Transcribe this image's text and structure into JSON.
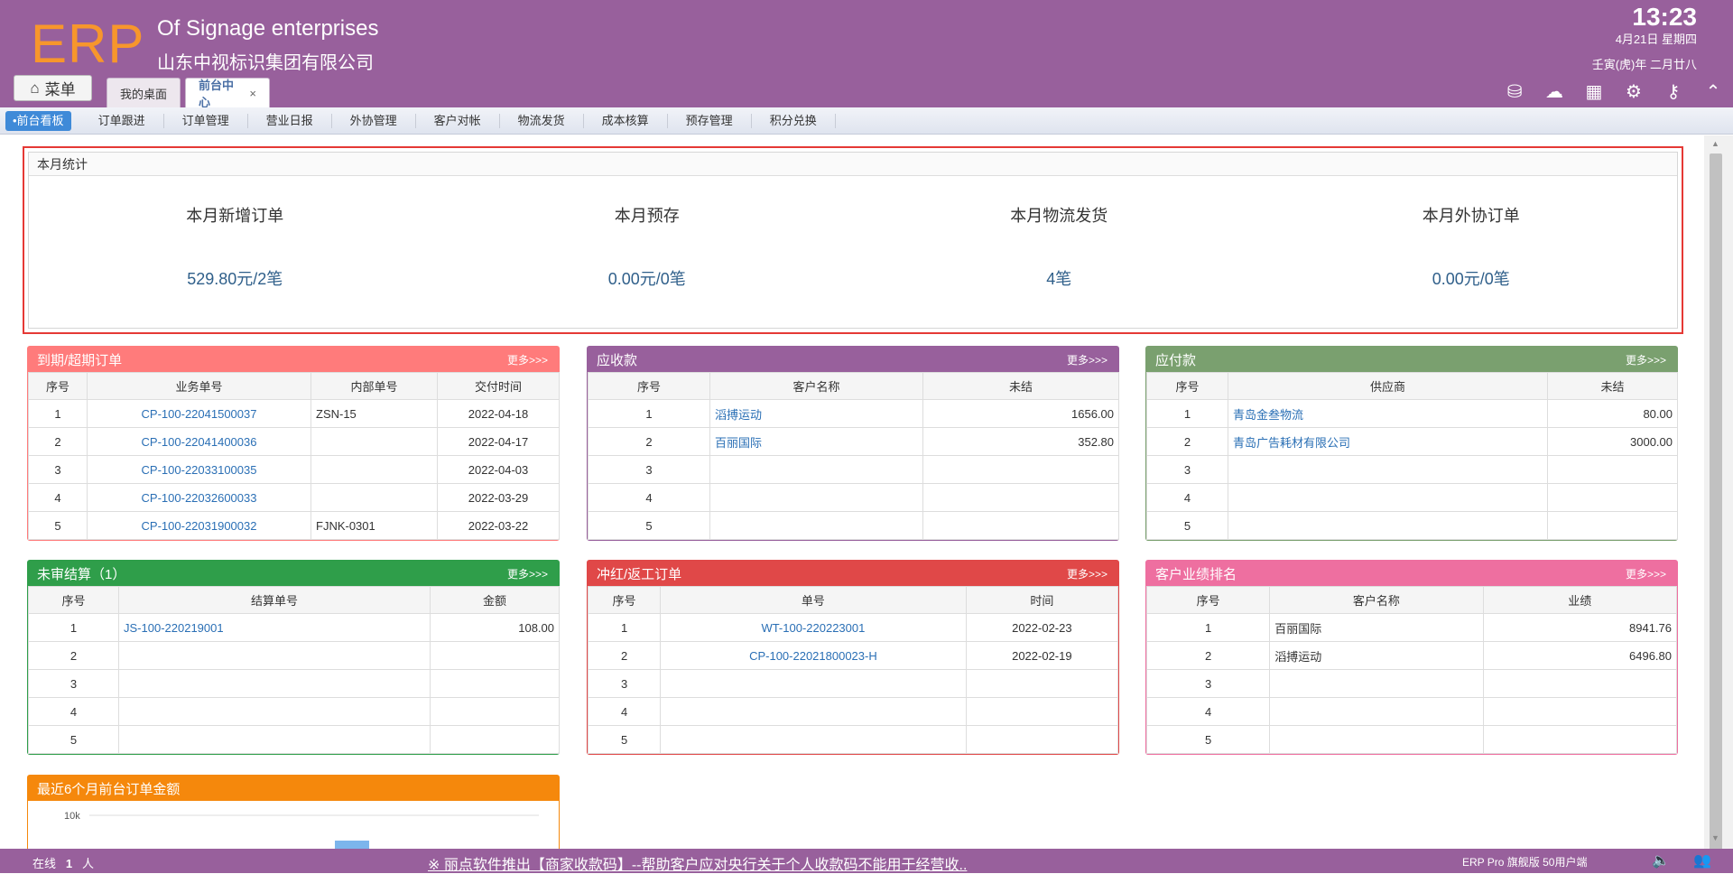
{
  "header": {
    "logo": "ERP",
    "brand_en": "Of Signage enterprises",
    "brand_cn": "山东中视标识集团有限公司",
    "time": "13:23",
    "date": "4月21日 星期四",
    "lunar": "壬寅(虎)年 二月廿八"
  },
  "menu_label": "菜单",
  "tabs": [
    {
      "label": "我的桌面"
    },
    {
      "label": "前台中心",
      "close": "×"
    }
  ],
  "nav": [
    "•前台看板",
    "订单跟进",
    "订单管理",
    "营业日报",
    "外协管理",
    "客户对帐",
    "物流发货",
    "成本核算",
    "预存管理",
    "积分兑换"
  ],
  "stats": {
    "title": "本月统计",
    "items": [
      {
        "label": "本月新增订单",
        "value": "529.80元/2笔"
      },
      {
        "label": "本月预存",
        "value": "0.00元/0笔"
      },
      {
        "label": "本月物流发货",
        "value": "4笔"
      },
      {
        "label": "本月外协订单",
        "value": "0.00元/0笔"
      }
    ]
  },
  "more_label": "更多>>>",
  "panels": [
    {
      "title": "到期/超期订单",
      "color": "#ff7b7b",
      "headers": [
        "序号",
        "业务单号",
        "内部单号",
        "交付时间"
      ],
      "rows": [
        [
          "1",
          "CP-100-22041500037",
          "ZSN-15",
          "2022-04-18"
        ],
        [
          "2",
          "CP-100-22041400036",
          "",
          "2022-04-17"
        ],
        [
          "3",
          "CP-100-22033100035",
          "",
          "2022-04-03"
        ],
        [
          "4",
          "CP-100-22032600033",
          "",
          "2022-03-29"
        ],
        [
          "5",
          "CP-100-22031900032",
          "FJNK-0301",
          "2022-03-22"
        ]
      ]
    },
    {
      "title": "应收款",
      "color": "#98609c",
      "headers": [
        "序号",
        "客户名称",
        "未结"
      ],
      "rows": [
        [
          "1",
          "滔搏运动",
          "1656.00"
        ],
        [
          "2",
          "百丽国际",
          "352.80"
        ],
        [
          "3",
          "",
          ""
        ],
        [
          "4",
          "",
          ""
        ],
        [
          "5",
          "",
          ""
        ]
      ]
    },
    {
      "title": "应付款",
      "color": "#7aa06f",
      "headers": [
        "序号",
        "供应商",
        "未结"
      ],
      "rows": [
        [
          "1",
          "青岛金叁物流",
          "80.00"
        ],
        [
          "2",
          "青岛广告耗材有限公司",
          "3000.00"
        ],
        [
          "3",
          "",
          ""
        ],
        [
          "4",
          "",
          ""
        ],
        [
          "5",
          "",
          ""
        ]
      ]
    },
    {
      "title": "未审结算（1）",
      "color": "#2f9e4a",
      "headers": [
        "序号",
        "结算单号",
        "金额"
      ],
      "rows": [
        [
          "1",
          "JS-100-220219001",
          "108.00"
        ],
        [
          "2",
          "",
          ""
        ],
        [
          "3",
          "",
          ""
        ],
        [
          "4",
          "",
          ""
        ],
        [
          "5",
          "",
          ""
        ]
      ]
    },
    {
      "title": "冲红/返工订单",
      "color": "#e04848",
      "headers": [
        "序号",
        "单号",
        "时间"
      ],
      "rows": [
        [
          "1",
          "WT-100-220223001",
          "2022-02-23"
        ],
        [
          "2",
          "CP-100-22021800023-H",
          "2022-02-19"
        ],
        [
          "3",
          "",
          ""
        ],
        [
          "4",
          "",
          ""
        ],
        [
          "5",
          "",
          ""
        ]
      ]
    },
    {
      "title": "客户业绩排名",
      "color": "#ee6fa0",
      "headers": [
        "序号",
        "客户名称",
        "业绩"
      ],
      "rows": [
        [
          "1",
          "百丽国际",
          "8941.76"
        ],
        [
          "2",
          "滔搏运动",
          "6496.80"
        ],
        [
          "3",
          "",
          ""
        ],
        [
          "4",
          "",
          ""
        ],
        [
          "5",
          "",
          ""
        ]
      ]
    }
  ],
  "chart_panel": {
    "title": "最近6个月前台订单金额",
    "color": "#f5880c"
  },
  "chart_data": {
    "type": "bar",
    "title": "最近6个月前台订单金额",
    "yticks": [
      "10k"
    ],
    "values_visible": "partially cropped"
  },
  "footer": {
    "online_label": "在线",
    "online_count": "1",
    "online_unit": "人",
    "news": "※ 丽点软件推出【商家收款码】--帮助客户应对央行关于个人收款码不能用于经营收..",
    "version": "ERP Pro 旗舰版 50用户端"
  }
}
